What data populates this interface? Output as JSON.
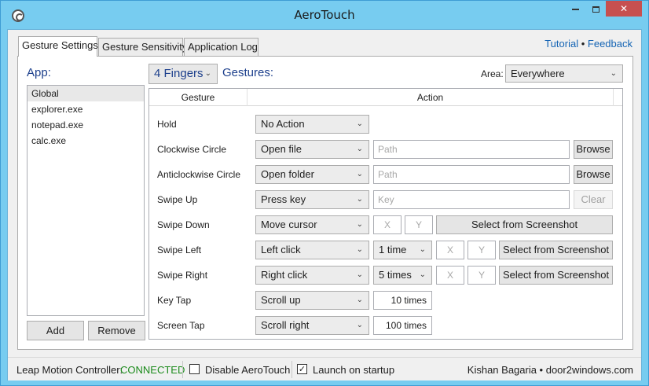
{
  "window": {
    "title": "AeroTouch",
    "close_glyph": "✕"
  },
  "tabs": [
    {
      "label": "Gesture Settings"
    },
    {
      "label": "Gesture Sensitivity"
    },
    {
      "label": "Application Log"
    }
  ],
  "links": {
    "tutorial": "Tutorial",
    "separator": "•",
    "feedback": "Feedback"
  },
  "app_panel": {
    "label": "App:",
    "items": [
      "Global",
      "explorer.exe",
      "notepad.exe",
      "calc.exe"
    ],
    "add_label": "Add",
    "remove_label": "Remove"
  },
  "gesture_header": {
    "fingers_value": "4 Fingers",
    "gestures_label": "Gestures:",
    "area_label": "Area:",
    "area_value": "Everywhere"
  },
  "grid": {
    "col_gesture": "Gesture",
    "col_action": "Action",
    "rows": [
      {
        "gesture": "Hold",
        "action": "No Action"
      },
      {
        "gesture": "Clockwise Circle",
        "action": "Open file",
        "input_placeholder": "Path",
        "button": "Browse"
      },
      {
        "gesture": "Anticlockwise Circle",
        "action": "Open folder",
        "input_placeholder": "Path",
        "button": "Browse"
      },
      {
        "gesture": "Swipe Up",
        "action": "Press key",
        "input_placeholder": "Key",
        "button": "Clear"
      },
      {
        "gesture": "Swipe Down",
        "action": "Move cursor",
        "x_placeholder": "X",
        "y_placeholder": "Y",
        "button": "Select from Screenshot"
      },
      {
        "gesture": "Swipe Left",
        "action": "Left click",
        "count": "1 time",
        "x_placeholder": "X",
        "y_placeholder": "Y",
        "button": "Select from Screenshot"
      },
      {
        "gesture": "Swipe Right",
        "action": "Right click",
        "count": "5 times",
        "x_placeholder": "X",
        "y_placeholder": "Y",
        "button": "Select from Screenshot"
      },
      {
        "gesture": "Key Tap",
        "action": "Scroll up",
        "times": "10 times"
      },
      {
        "gesture": "Screen Tap",
        "action": "Scroll right",
        "times": "100 times"
      }
    ]
  },
  "status": {
    "controller_label": "Leap Motion Controller:",
    "controller_value": "CONNECTED",
    "disable_label": "Disable AeroTouch",
    "disable_checked": false,
    "launch_label": "Launch on startup",
    "launch_checked": true,
    "credit": "Kishan Bagaria • door2windows.com"
  },
  "colors": {
    "window_frame": "#77ccf0",
    "accent_text": "#1c3f8c",
    "link": "#1464b4",
    "connected": "#1a8a1a",
    "close_button": "#c75050"
  }
}
